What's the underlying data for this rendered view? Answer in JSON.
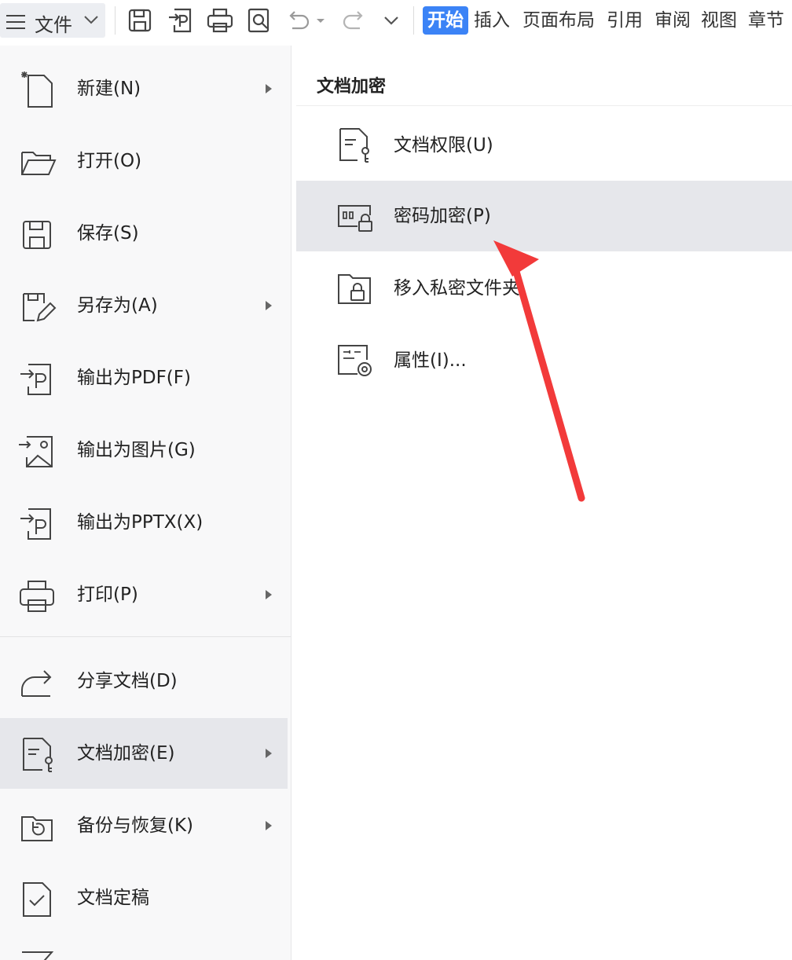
{
  "toolbar": {
    "file_label": "文件",
    "icons": [
      "save-icon",
      "export-pdf-icon",
      "print-icon",
      "print-preview-icon",
      "undo-icon",
      "redo-icon",
      "more-dropdown-icon"
    ],
    "tabs": [
      "开始",
      "插入",
      "页面布局",
      "引用",
      "审阅",
      "视图",
      "章节"
    ],
    "active_tab": "开始"
  },
  "left_menu": {
    "items": [
      {
        "label": "新建(N)",
        "icon": "new-document-icon",
        "has_submenu": true
      },
      {
        "label": "打开(O)",
        "icon": "folder-open-icon",
        "has_submenu": false
      },
      {
        "label": "保存(S)",
        "icon": "save-icon",
        "has_submenu": false
      },
      {
        "label": "另存为(A)",
        "icon": "save-as-icon",
        "has_submenu": true
      },
      {
        "label": "输出为PDF(F)",
        "icon": "export-pdf-icon",
        "has_submenu": false
      },
      {
        "label": "输出为图片(G)",
        "icon": "export-image-icon",
        "has_submenu": false
      },
      {
        "label": "输出为PPTX(X)",
        "icon": "export-pptx-icon",
        "has_submenu": false
      },
      {
        "label": "打印(P)",
        "icon": "print-icon",
        "has_submenu": true
      },
      {
        "label": "分享文档(D)",
        "icon": "share-icon",
        "has_submenu": false
      },
      {
        "label": "文档加密(E)",
        "icon": "document-key-icon",
        "has_submenu": true,
        "selected": true
      },
      {
        "label": "备份与恢复(K)",
        "icon": "backup-restore-icon",
        "has_submenu": true
      },
      {
        "label": "文档定稿",
        "icon": "document-finalize-icon",
        "has_submenu": false
      }
    ]
  },
  "submenu": {
    "title": "文档加密",
    "items": [
      {
        "label": "文档权限(U)",
        "icon": "document-permission-icon"
      },
      {
        "label": "密码加密(P)",
        "icon": "password-lock-icon",
        "selected": true
      },
      {
        "label": "移入私密文件夹",
        "icon": "private-folder-icon"
      },
      {
        "label": "属性(I)...",
        "icon": "properties-icon"
      }
    ]
  },
  "colors": {
    "active_tab_bg": "#3b83f6",
    "selected_bg": "#e6e7eb",
    "annotation_arrow": "#f23a3a"
  }
}
